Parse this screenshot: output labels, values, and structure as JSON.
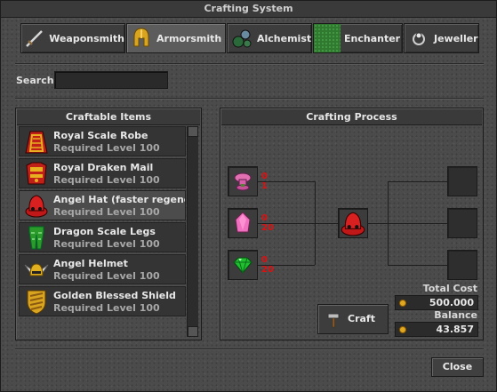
{
  "window": {
    "title": "Crafting System"
  },
  "tabs": [
    {
      "label": "Weaponsmith",
      "icon": "sword-icon"
    },
    {
      "label": "Armorsmith",
      "icon": "golden-helmet-icon",
      "active": true
    },
    {
      "label": "Alchemist",
      "icon": "potion-icon"
    },
    {
      "label": "Enchanter",
      "icon": "grass-icon"
    },
    {
      "label": "Jeweller",
      "icon": "gem-ring-icon"
    }
  ],
  "search": {
    "label": "Search",
    "value": ""
  },
  "craftable": {
    "title": "Craftable Items",
    "items": [
      {
        "name": "Royal Scale Robe",
        "level": "Required Level 100",
        "icon": "royal-robe-icon"
      },
      {
        "name": "Royal Draken Mail",
        "level": "Required Level 100",
        "icon": "draken-mail-icon"
      },
      {
        "name": "Angel Hat (faster regeneration)",
        "level": "Required Level 100",
        "icon": "red-hat-icon"
      },
      {
        "name": "Dragon Scale Legs",
        "level": "Required Level 100",
        "icon": "green-legs-icon"
      },
      {
        "name": "Angel Helmet",
        "level": "Required Level 100",
        "icon": "winged-helmet-icon"
      },
      {
        "name": "Golden Blessed Shield",
        "level": "Required Level 100",
        "icon": "golden-shield-icon"
      }
    ]
  },
  "process": {
    "title": "Crafting Process",
    "ingredients": [
      {
        "icon": "pink-mushroom-icon",
        "have": "0",
        "need": "1"
      },
      {
        "icon": "pink-crystal-icon",
        "have": "0",
        "need": "20"
      },
      {
        "icon": "green-gem-icon",
        "have": "0",
        "need": "20"
      }
    ],
    "result_icon": "red-hat-icon",
    "total_cost_label": "Total Cost",
    "total_cost": "500.000",
    "balance_label": "Balance",
    "balance": "43.857",
    "craft_label": "Craft"
  },
  "footer": {
    "close_label": "Close"
  },
  "colors": {
    "requirement_red": "#e01010",
    "coin_gold": "#e0a820"
  }
}
